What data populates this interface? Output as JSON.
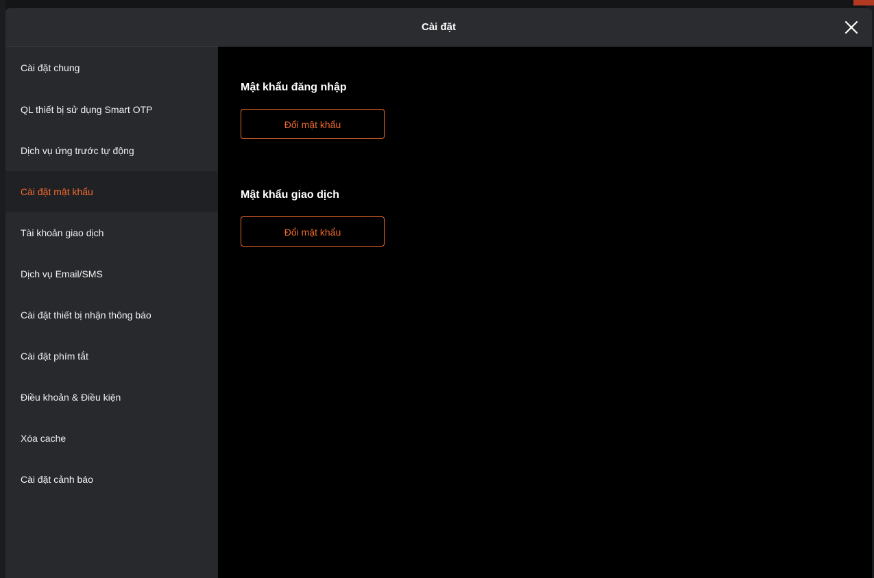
{
  "modal": {
    "title": "Cài đặt",
    "close_icon": "close-icon"
  },
  "sidebar": {
    "items": [
      {
        "label": "Cài đặt chung",
        "active": false
      },
      {
        "label": "QL thiết bị sử dụng Smart OTP",
        "active": false
      },
      {
        "label": "Dịch vụ ứng trước tự động",
        "active": false
      },
      {
        "label": "Cài đặt mật khẩu",
        "active": true
      },
      {
        "label": "Tài khoản giao dịch",
        "active": false
      },
      {
        "label": "Dịch vụ Email/SMS",
        "active": false
      },
      {
        "label": "Cài đặt thiết bị nhận thông báo",
        "active": false
      },
      {
        "label": "Cài đặt phím tắt",
        "active": false
      },
      {
        "label": "Điều khoản & Điều kiện",
        "active": false
      },
      {
        "label": "Xóa cache",
        "active": false
      },
      {
        "label": "Cài đặt cảnh báo",
        "active": false
      }
    ]
  },
  "content": {
    "login_password": {
      "title": "Mật khẩu đăng nhập",
      "button_label": "Đổi mật khẩu"
    },
    "trading_password": {
      "title": "Mật khẩu giao dịch",
      "button_label": "Đổi mật khẩu"
    }
  },
  "colors": {
    "accent": "#f06a2e",
    "sidebar_bg": "#28292d",
    "header_bg": "#2b2c30",
    "content_bg": "#000000"
  }
}
